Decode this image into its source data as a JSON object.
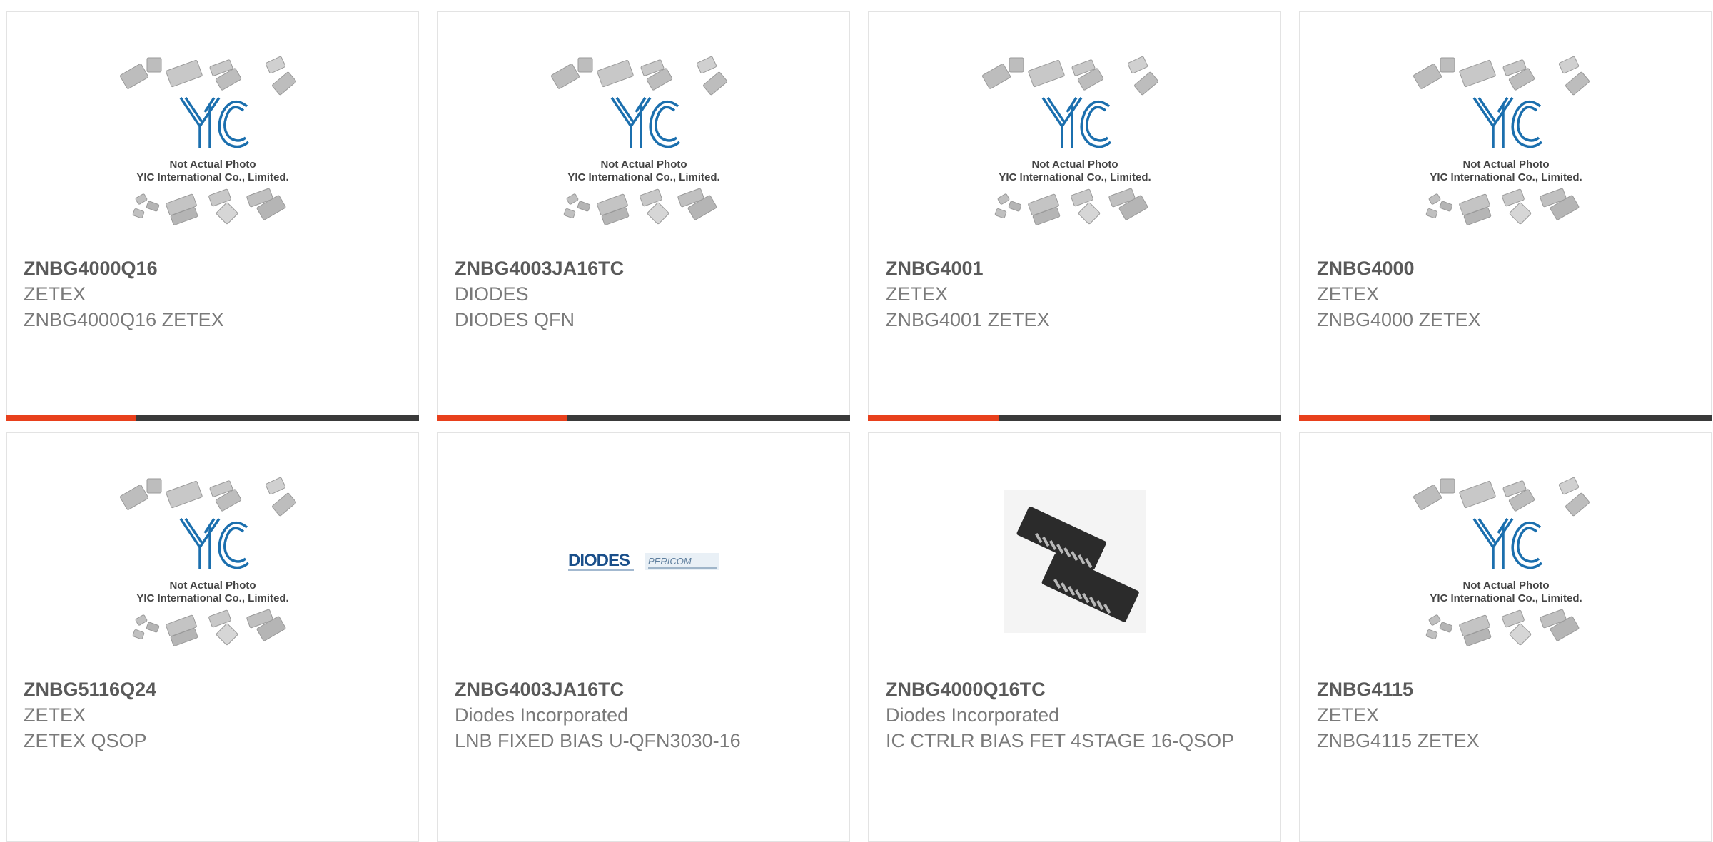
{
  "products": [
    {
      "part_number": "ZNBG4000Q16",
      "manufacturer": "ZETEX",
      "description": "ZNBG4000Q16 ZETEX",
      "image": "yic-placeholder",
      "show_bar": true
    },
    {
      "part_number": "ZNBG4003JA16TC",
      "manufacturer": "DIODES",
      "description": "DIODES QFN",
      "image": "yic-placeholder",
      "show_bar": true
    },
    {
      "part_number": "ZNBG4001",
      "manufacturer": "ZETEX",
      "description": "ZNBG4001 ZETEX",
      "image": "yic-placeholder",
      "show_bar": true
    },
    {
      "part_number": "ZNBG4000",
      "manufacturer": "ZETEX",
      "description": "ZNBG4000 ZETEX",
      "image": "yic-placeholder",
      "show_bar": true
    },
    {
      "part_number": "ZNBG5116Q24",
      "manufacturer": "ZETEX",
      "description": "ZETEX QSOP",
      "image": "yic-placeholder",
      "show_bar": false
    },
    {
      "part_number": "ZNBG4003JA16TC",
      "manufacturer": "Diodes Incorporated",
      "description": "LNB FIXED BIAS U-QFN3030-16",
      "image": "diodes-pericom-logo",
      "show_bar": false
    },
    {
      "part_number": "ZNBG4000Q16TC",
      "manufacturer": "Diodes Incorporated",
      "description": "IC CTRLR BIAS FET 4STAGE 16-QSOP",
      "image": "qsop-chip-photo",
      "show_bar": false
    },
    {
      "part_number": "ZNBG4115",
      "manufacturer": "ZETEX",
      "description": "ZNBG4115 ZETEX",
      "image": "yic-placeholder",
      "show_bar": false
    }
  ],
  "placeholder": {
    "brand": "YIC",
    "line1": "Not Actual Photo",
    "line2": "YIC International Co., Limited."
  },
  "logo": {
    "diodes": "DIODES",
    "pericom": "PERICOM"
  },
  "colors": {
    "accent": "#e8401c",
    "bar_dark": "#3a3a3a",
    "yic_blue": "#1b6fae",
    "card_border": "#e3e3e3"
  }
}
